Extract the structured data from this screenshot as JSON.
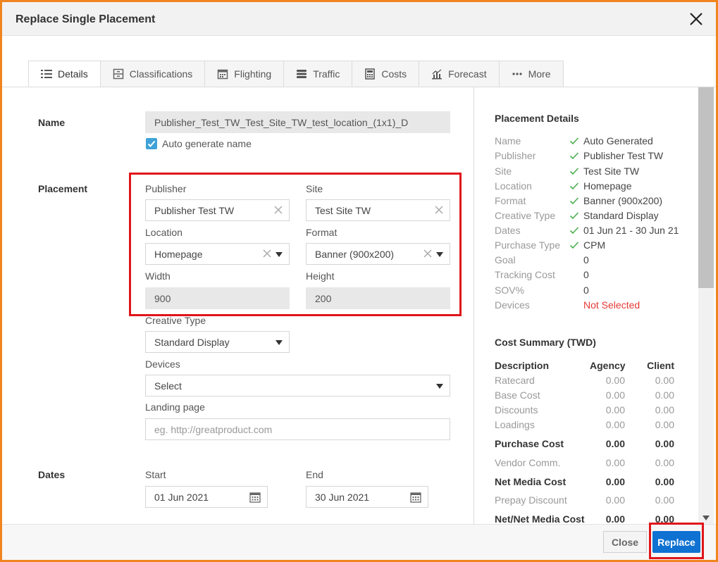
{
  "dialog": {
    "title": "Replace Single Placement"
  },
  "tabs": [
    {
      "label": "Details",
      "icon": "list-icon"
    },
    {
      "label": "Classifications",
      "icon": "archive-icon"
    },
    {
      "label": "Flighting",
      "icon": "calendar-icon"
    },
    {
      "label": "Traffic",
      "icon": "stack-icon"
    },
    {
      "label": "Costs",
      "icon": "calculator-icon"
    },
    {
      "label": "Forecast",
      "icon": "chart-icon"
    },
    {
      "label": "More",
      "icon": "more-icon"
    }
  ],
  "form": {
    "name_section": "Name",
    "name_value": "Publisher_Test_TW_Test_Site_TW_test_location_(1x1)_D",
    "auto_generate_label": "Auto generate name",
    "placement_section": "Placement",
    "publisher_label": "Publisher",
    "publisher_value": "Publisher Test TW",
    "site_label": "Site",
    "site_value": "Test Site TW",
    "location_label": "Location",
    "location_value": "Homepage",
    "format_label": "Format",
    "format_value": "Banner (900x200)",
    "width_label": "Width",
    "width_value": "900",
    "height_label": "Height",
    "height_value": "200",
    "creative_type_label": "Creative Type",
    "creative_type_value": "Standard Display",
    "devices_label": "Devices",
    "devices_value": "Select",
    "landing_label": "Landing page",
    "landing_placeholder": "eg. http://greatproduct.com",
    "dates_section": "Dates",
    "start_label": "Start",
    "start_value": "01 Jun 2021",
    "end_label": "End",
    "end_value": "30 Jun 2021"
  },
  "details": {
    "title": "Placement Details",
    "rows": [
      {
        "key": "Name",
        "value": "Auto Generated",
        "check": true
      },
      {
        "key": "Publisher",
        "value": "Publisher Test TW",
        "check": true
      },
      {
        "key": "Site",
        "value": "Test Site TW",
        "check": true
      },
      {
        "key": "Location",
        "value": "Homepage",
        "check": true
      },
      {
        "key": "Format",
        "value": "Banner (900x200)",
        "check": true
      },
      {
        "key": "Creative Type",
        "value": "Standard Display",
        "check": true
      },
      {
        "key": "Dates",
        "value": "01 Jun 21 - 30 Jun 21",
        "check": true
      },
      {
        "key": "Purchase Type",
        "value": "CPM",
        "check": true
      },
      {
        "key": "Goal",
        "value": "0",
        "check": false
      },
      {
        "key": "Tracking Cost",
        "value": "0",
        "check": false
      },
      {
        "key": "SOV%",
        "value": "0",
        "check": false
      },
      {
        "key": "Devices",
        "value": "Not Selected",
        "check": false
      }
    ]
  },
  "cost_summary": {
    "title": "Cost Summary (TWD)",
    "headers": {
      "description": "Description",
      "agency": "Agency",
      "client": "Client"
    },
    "rows": [
      {
        "label": "Ratecard",
        "agency": "0.00",
        "client": "0.00",
        "bold": false
      },
      {
        "label": "Base Cost",
        "agency": "0.00",
        "client": "0.00",
        "bold": false
      },
      {
        "label": "Discounts",
        "agency": "0.00",
        "client": "0.00",
        "bold": false
      },
      {
        "label": "Loadings",
        "agency": "0.00",
        "client": "0.00",
        "bold": false
      },
      {
        "label": "Purchase Cost",
        "agency": "0.00",
        "client": "0.00",
        "bold": true
      },
      {
        "label": "Vendor Comm.",
        "agency": "0.00",
        "client": "0.00",
        "bold": false
      },
      {
        "label": "Net Media Cost",
        "agency": "0.00",
        "client": "0.00",
        "bold": true
      },
      {
        "label": "Prepay Discount",
        "agency": "0.00",
        "client": "0.00",
        "bold": false
      },
      {
        "label": "Net/Net Media Cost",
        "agency": "0.00",
        "client": "0.00",
        "bold": true
      }
    ]
  },
  "footer": {
    "close_label": "Close",
    "replace_label": "Replace"
  },
  "colors": {
    "accent": "#0f71d2",
    "frame": "#f0841f",
    "highlight": "#e0151b",
    "check": "#4caf50",
    "error": "#e53935"
  }
}
